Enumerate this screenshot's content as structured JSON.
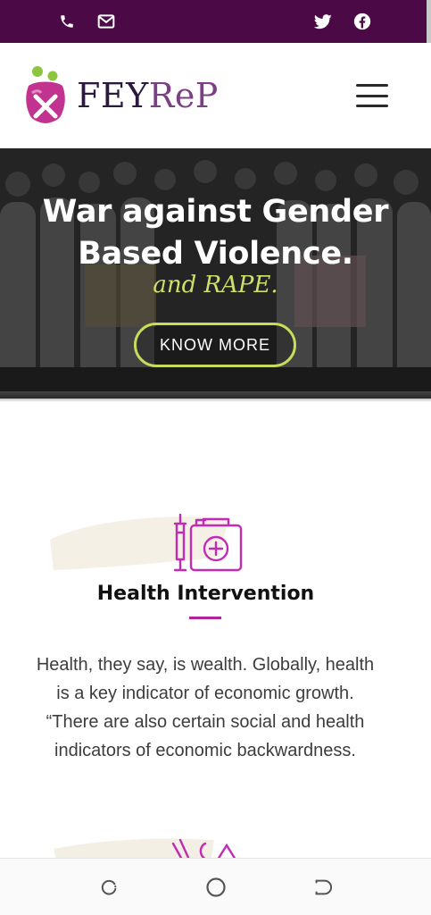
{
  "topbar": {
    "background": "#4b0a46",
    "icons_left": [
      "phone-icon",
      "mail-icon"
    ],
    "icons_right": [
      "twitter-icon",
      "facebook-icon"
    ]
  },
  "header": {
    "logo_text_main": "FEY",
    "logo_text_accent": "ReP",
    "menu_icon": "hamburger-menu-icon"
  },
  "hero": {
    "title": "War against Gender Based Violence.",
    "script": "and RAPE.",
    "button_label": "KNOW MORE",
    "accent": "#c8dc5a"
  },
  "health": {
    "icon": "medical-kit-syringe-icon",
    "title": "Health Intervention",
    "body": "Health, they say, is wealth. Globally, health is a key indicator of economic growth. “There are also certain social and health indicators of economic backwardness.",
    "accent": "#b0249e"
  },
  "navbar": {
    "buttons": [
      "recents-icon",
      "home-icon",
      "back-icon"
    ]
  }
}
